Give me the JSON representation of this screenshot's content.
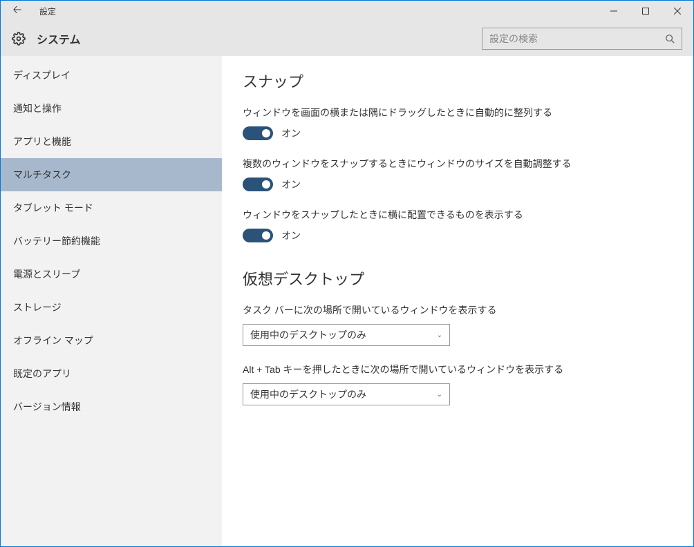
{
  "window": {
    "title": "設定"
  },
  "header": {
    "title": "システム",
    "search_placeholder": "設定の検索"
  },
  "sidebar": {
    "items": [
      {
        "label": "ディスプレイ",
        "selected": false
      },
      {
        "label": "通知と操作",
        "selected": false
      },
      {
        "label": "アプリと機能",
        "selected": false
      },
      {
        "label": "マルチタスク",
        "selected": true
      },
      {
        "label": "タブレット モード",
        "selected": false
      },
      {
        "label": "バッテリー節約機能",
        "selected": false
      },
      {
        "label": "電源とスリープ",
        "selected": false
      },
      {
        "label": "ストレージ",
        "selected": false
      },
      {
        "label": "オフライン マップ",
        "selected": false
      },
      {
        "label": "既定のアプリ",
        "selected": false
      },
      {
        "label": "バージョン情報",
        "selected": false
      }
    ]
  },
  "main": {
    "section1": {
      "heading": "スナップ",
      "settings": [
        {
          "label": "ウィンドウを画面の横または隅にドラッグしたときに自動的に整列する",
          "state": "オン"
        },
        {
          "label": "複数のウィンドウをスナップするときにウィンドウのサイズを自動調整する",
          "state": "オン"
        },
        {
          "label": "ウィンドウをスナップしたときに横に配置できるものを表示する",
          "state": "オン"
        }
      ]
    },
    "section2": {
      "heading": "仮想デスクトップ",
      "settings": [
        {
          "label": "タスク バーに次の場所で開いているウィンドウを表示する",
          "value": "使用中のデスクトップのみ"
        },
        {
          "label": "Alt + Tab キーを押したときに次の場所で開いているウィンドウを表示する",
          "value": "使用中のデスクトップのみ"
        }
      ]
    }
  }
}
